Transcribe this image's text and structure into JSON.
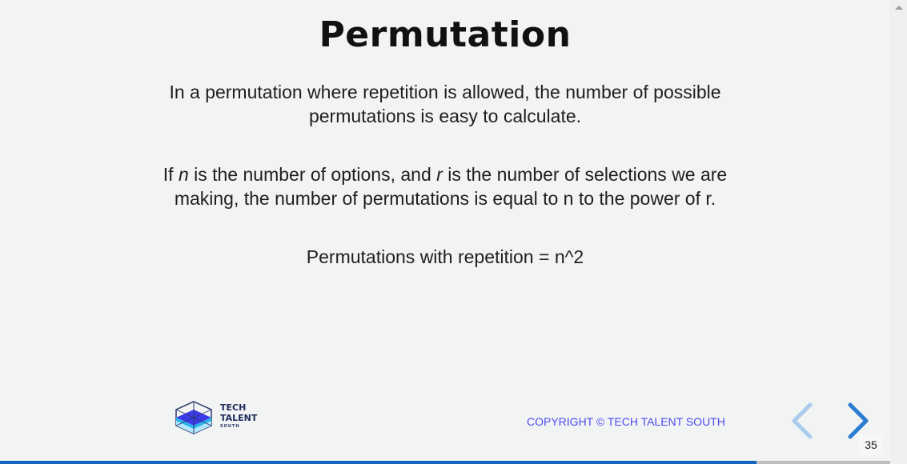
{
  "slide": {
    "title": "Permutation",
    "para1_line1": "In a permutation where repetition is allowed, the number of possible",
    "para1_line2": "permutations is easy to calculate.",
    "para2_a": "If ",
    "para2_n": "n",
    "para2_b": " is the number of options, and ",
    "para2_r": "r",
    "para2_c": " is the number of selections we are",
    "para2_line2": "making, the number of permutations is equal to n to the power of r.",
    "formula": "Permutations with repetition = n^2"
  },
  "footer": {
    "logo_line1": "TECH",
    "logo_line2": "TALENT",
    "logo_line3": "SOUTH",
    "copyright": "COPYRIGHT © TECH TALENT SOUTH",
    "page_number": "35",
    "progress_percent": 85
  },
  "colors": {
    "accent": "#1565c0",
    "copyright": "#4a4cf0",
    "prev_arrow": "#a9cbed",
    "next_arrow": "#2b7bd3"
  }
}
